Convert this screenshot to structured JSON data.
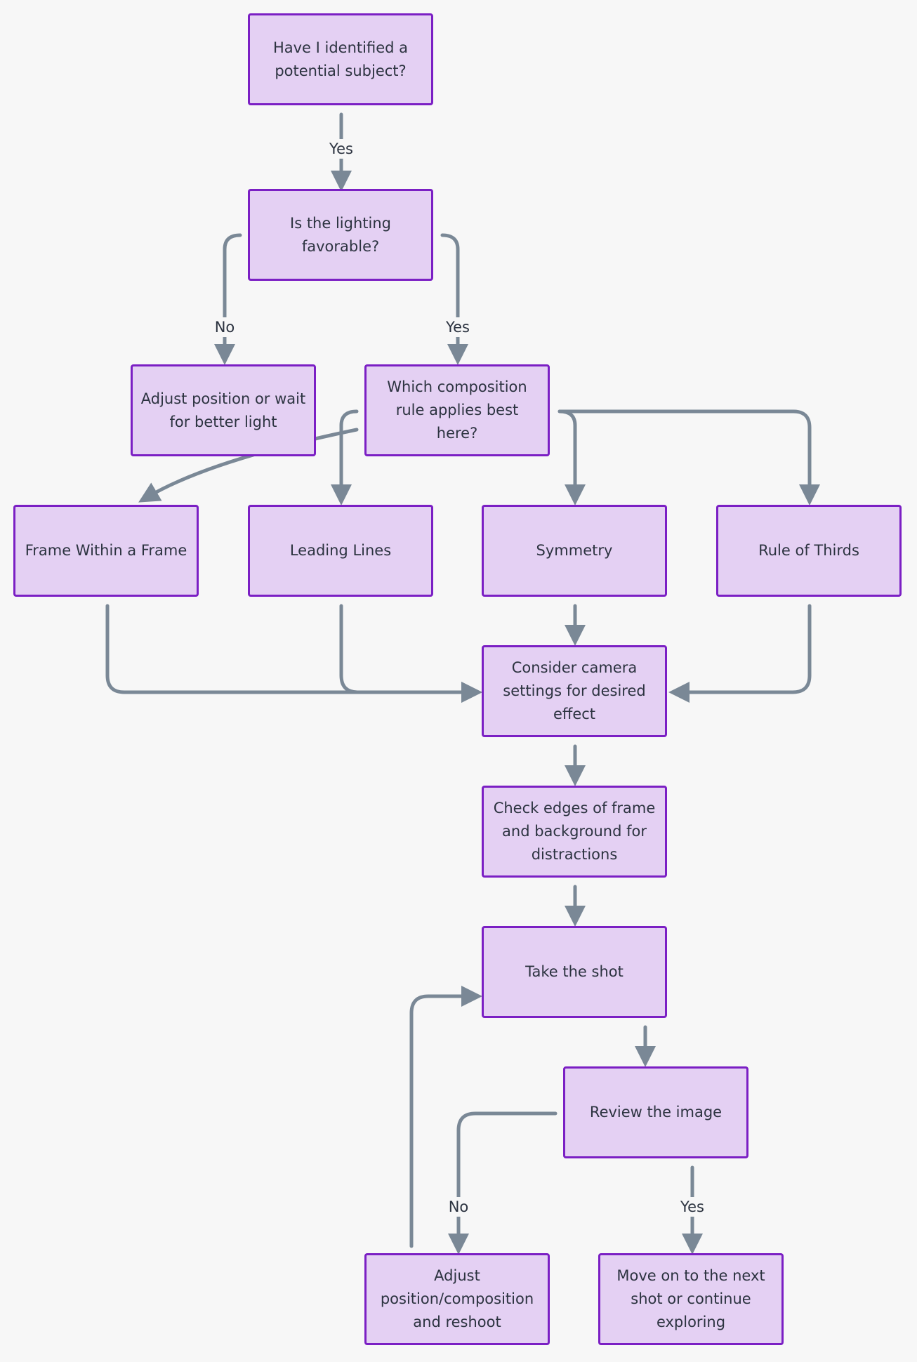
{
  "colors": {
    "background": "#f7f7f7",
    "node_fill": "#e4d0f3",
    "node_border": "#7b1fc4",
    "edge": "#7a8896",
    "text": "#2c3340"
  },
  "nodes": {
    "subject": "Have I identified a potential subject?",
    "lighting": "Is the lighting favorable?",
    "adjust_light": "Adjust position or wait for better light",
    "composition": "Which composition rule applies best here?",
    "frame": "Frame Within a Frame",
    "leading": "Leading Lines",
    "symmetry": "Symmetry",
    "thirds": "Rule of Thirds",
    "camera": "Consider camera settings for desired effect",
    "edges": "Check edges of frame and background for distractions",
    "shot": "Take the shot",
    "review": "Review the image",
    "reshoot": "Adjust position/composition and reshoot",
    "move_on": "Move on to the next shot or continue exploring"
  },
  "edge_labels": {
    "subject_lighting": "Yes",
    "lighting_no": "No",
    "lighting_yes": "Yes",
    "review_no": "No",
    "review_yes": "Yes"
  }
}
